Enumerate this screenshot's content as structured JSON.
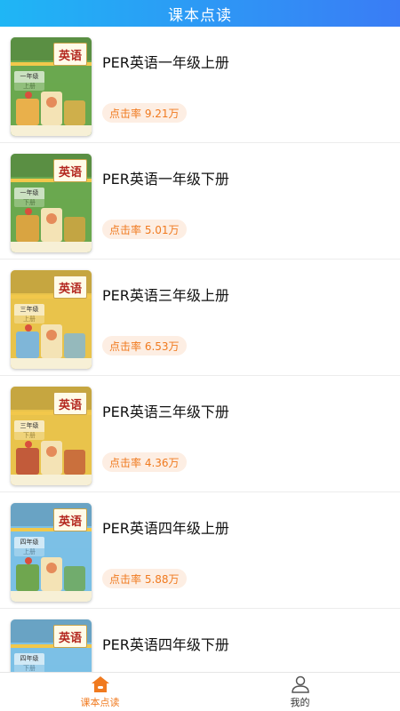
{
  "header": {
    "title": "课本点读"
  },
  "books": [
    {
      "title": "PER英语一年级上册",
      "clicks": "点击率 9.21万",
      "cover_color": "#6aa84f",
      "art_color": "#e9b04b",
      "grade": "一年级",
      "volume": "上册"
    },
    {
      "title": "PER英语一年级下册",
      "clicks": "点击率 5.01万",
      "cover_color": "#6aa84f",
      "art_color": "#d9a441",
      "grade": "一年级",
      "volume": "下册"
    },
    {
      "title": "PER英语三年级上册",
      "clicks": "点击率 6.53万",
      "cover_color": "#e9c34b",
      "art_color": "#7fb6d8",
      "grade": "三年级",
      "volume": "上册"
    },
    {
      "title": "PER英语三年级下册",
      "clicks": "点击率 4.36万",
      "cover_color": "#e9c34b",
      "art_color": "#c25b3a",
      "grade": "三年级",
      "volume": "下册"
    },
    {
      "title": "PER英语四年级上册",
      "clicks": "点击率 5.88万",
      "cover_color": "#7cc0e6",
      "art_color": "#6fa64f",
      "grade": "四年级",
      "volume": "上册"
    },
    {
      "title": "PER英语四年级下册",
      "clicks": "",
      "cover_color": "#7cc0e6",
      "art_color": "#a8774a",
      "grade": "四年级",
      "volume": "下册"
    }
  ],
  "cover_label": "英语",
  "tabs": [
    {
      "label": "课本点读",
      "icon": "home-icon",
      "active": true,
      "color": "#f07a1f"
    },
    {
      "label": "我的",
      "icon": "user-icon",
      "active": false,
      "color": "#333333"
    }
  ]
}
